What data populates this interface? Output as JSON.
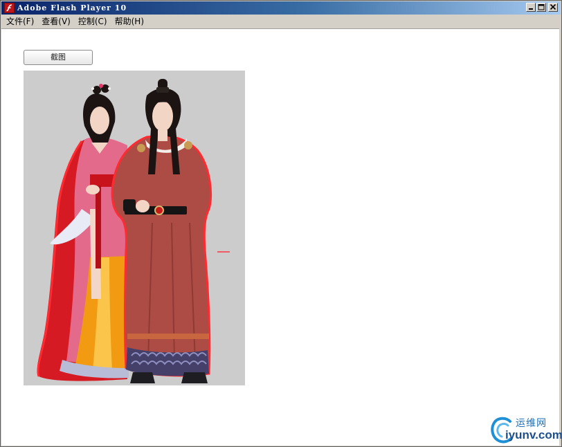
{
  "window": {
    "title": "Adobe Flash Player 10",
    "app_icon": "flash-icon",
    "caption_buttons": [
      "minimize-icon",
      "maximize-icon",
      "close-icon"
    ]
  },
  "menu": {
    "items": [
      {
        "label": "文件(F)",
        "name": "file"
      },
      {
        "label": "查看(V)",
        "name": "view"
      },
      {
        "label": "控制(C)",
        "name": "control"
      },
      {
        "label": "帮助(H)",
        "name": "help"
      }
    ]
  },
  "stage": {
    "capture_button_label": "截图",
    "picture_background": "#cccccc"
  },
  "watermark": {
    "cn_text": "运维网",
    "url_text": "iyunv.com",
    "color": "#1f6fb8"
  }
}
